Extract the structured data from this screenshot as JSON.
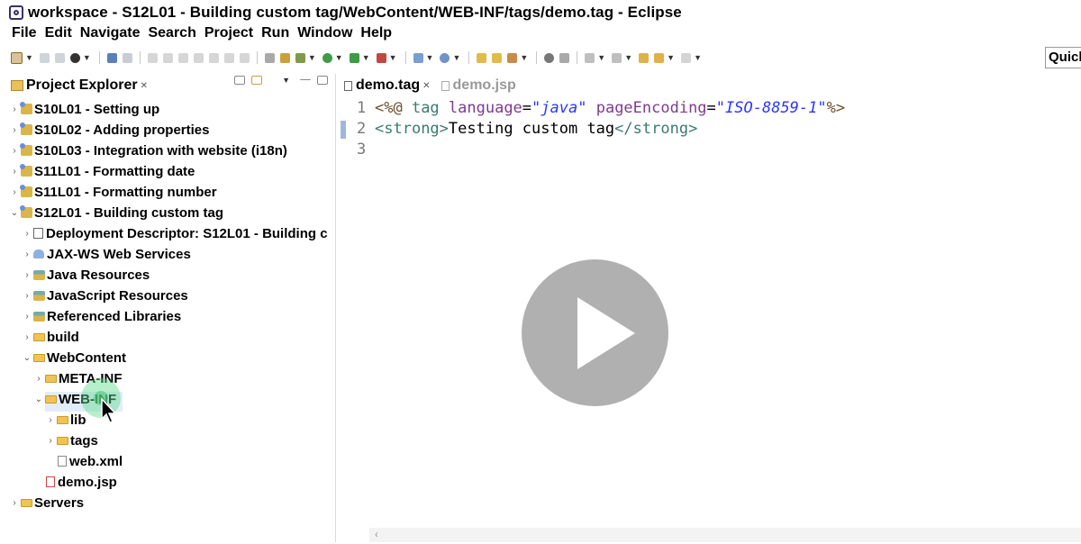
{
  "window": {
    "title": "workspace - S12L01 - Building custom tag/WebContent/WEB-INF/tags/demo.tag - Eclipse"
  },
  "menu": [
    "File",
    "Edit",
    "Navigate",
    "Search",
    "Project",
    "Run",
    "Window",
    "Help"
  ],
  "toolbar": {
    "quick_access_label": "Quick"
  },
  "explorer": {
    "title": "Project Explorer",
    "items": [
      {
        "label": "S10L01 - Setting up",
        "icon": "project-icon",
        "expanded": false
      },
      {
        "label": "S10L02 - Adding properties",
        "icon": "project-icon",
        "expanded": false
      },
      {
        "label": "S10L03 - Integration with website (i18n)",
        "icon": "project-icon",
        "expanded": false
      },
      {
        "label": "S11L01 - Formatting date",
        "icon": "project-icon",
        "expanded": false
      },
      {
        "label": "S11L01 - Formatting number",
        "icon": "project-icon",
        "expanded": false
      },
      {
        "label": "S12L01 - Building custom tag",
        "icon": "project-icon",
        "expanded": true
      },
      {
        "label": "Deployment Descriptor: S12L01 - Building c",
        "icon": "deployment-descriptor-icon",
        "expanded": false
      },
      {
        "label": "JAX-WS Web Services",
        "icon": "web-services-icon",
        "expanded": false
      },
      {
        "label": "Java Resources",
        "icon": "java-resources-icon",
        "expanded": false
      },
      {
        "label": "JavaScript Resources",
        "icon": "javascript-resources-icon",
        "expanded": false
      },
      {
        "label": "Referenced Libraries",
        "icon": "library-icon",
        "expanded": false
      },
      {
        "label": "build",
        "icon": "folder-icon",
        "expanded": false
      },
      {
        "label": "WebContent",
        "icon": "folder-icon",
        "expanded": true
      },
      {
        "label": "META-INF",
        "icon": "folder-icon",
        "expanded": false
      },
      {
        "label": "WEB-INF",
        "icon": "folder-icon",
        "expanded": true,
        "selected": true
      },
      {
        "label": "lib",
        "icon": "folder-icon",
        "expanded": false
      },
      {
        "label": "tags",
        "icon": "folder-icon",
        "expanded": false
      },
      {
        "label": "web.xml",
        "icon": "xml-file-icon"
      },
      {
        "label": "demo.jsp",
        "icon": "jsp-file-icon"
      },
      {
        "label": "Servers",
        "icon": "folder-icon",
        "expanded": false
      }
    ]
  },
  "editor": {
    "tabs": [
      {
        "label": "demo.tag",
        "active": true
      },
      {
        "label": "demo.jsp",
        "active": false
      }
    ],
    "lines": [
      {
        "num": "1",
        "parts": [
          {
            "t": "<%@ ",
            "c": "kw"
          },
          {
            "t": "tag ",
            "c": "tag"
          },
          {
            "t": "language",
            "c": "attr"
          },
          {
            "t": "=",
            "c": "txt"
          },
          {
            "t": "\"java\"",
            "c": "str"
          },
          {
            "t": " ",
            "c": "txt"
          },
          {
            "t": "pageEncoding",
            "c": "attr"
          },
          {
            "t": "=",
            "c": "txt"
          },
          {
            "t": "\"ISO-8859-1\"",
            "c": "str"
          },
          {
            "t": "%>",
            "c": "kw"
          }
        ]
      },
      {
        "num": "2",
        "parts": [
          {
            "t": "<",
            "c": "tag"
          },
          {
            "t": "strong",
            "c": "tag"
          },
          {
            "t": ">",
            "c": "tag"
          },
          {
            "t": "Testing custom tag",
            "c": "txt"
          },
          {
            "t": "</",
            "c": "tag"
          },
          {
            "t": "strong",
            "c": "tag"
          },
          {
            "t": ">",
            "c": "tag"
          }
        ]
      },
      {
        "num": "3",
        "parts": []
      }
    ]
  },
  "overlay": {
    "icon": "play-icon"
  }
}
